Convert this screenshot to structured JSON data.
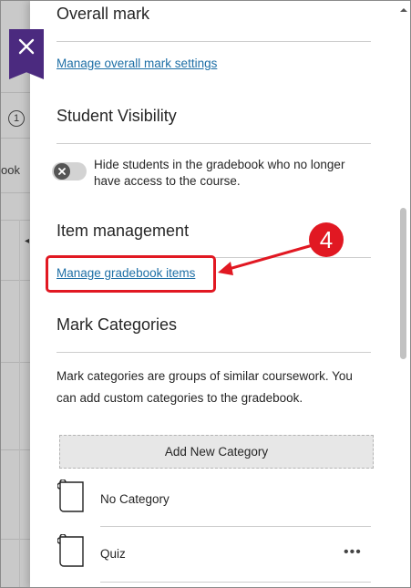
{
  "background": {
    "step_number": "1",
    "partial_text": "ook"
  },
  "close_button": {
    "icon": "close-icon"
  },
  "panel": {
    "overall_mark": {
      "heading": "Overall mark",
      "link": "Manage overall mark settings"
    },
    "student_visibility": {
      "heading": "Student Visibility",
      "toggle_state": "off",
      "toggle_label": "Hide students in the gradebook who no longer have access to the course."
    },
    "item_management": {
      "heading": "Item management",
      "link": "Manage gradebook items"
    },
    "mark_categories": {
      "heading": "Mark Categories",
      "description": "Mark categories are groups of similar coursework. You can add custom categories to the gradebook.",
      "add_button": "Add New Category",
      "categories": [
        {
          "label": "No Category",
          "icon": "document-icon"
        },
        {
          "label": "Quiz",
          "icon": "document-icon",
          "more": "•••"
        }
      ]
    }
  },
  "annotation": {
    "step": "4",
    "color": "#e11822"
  },
  "colors": {
    "accent": "#4b2a7f",
    "link": "#1e6fa6",
    "annotation": "#e11822"
  }
}
